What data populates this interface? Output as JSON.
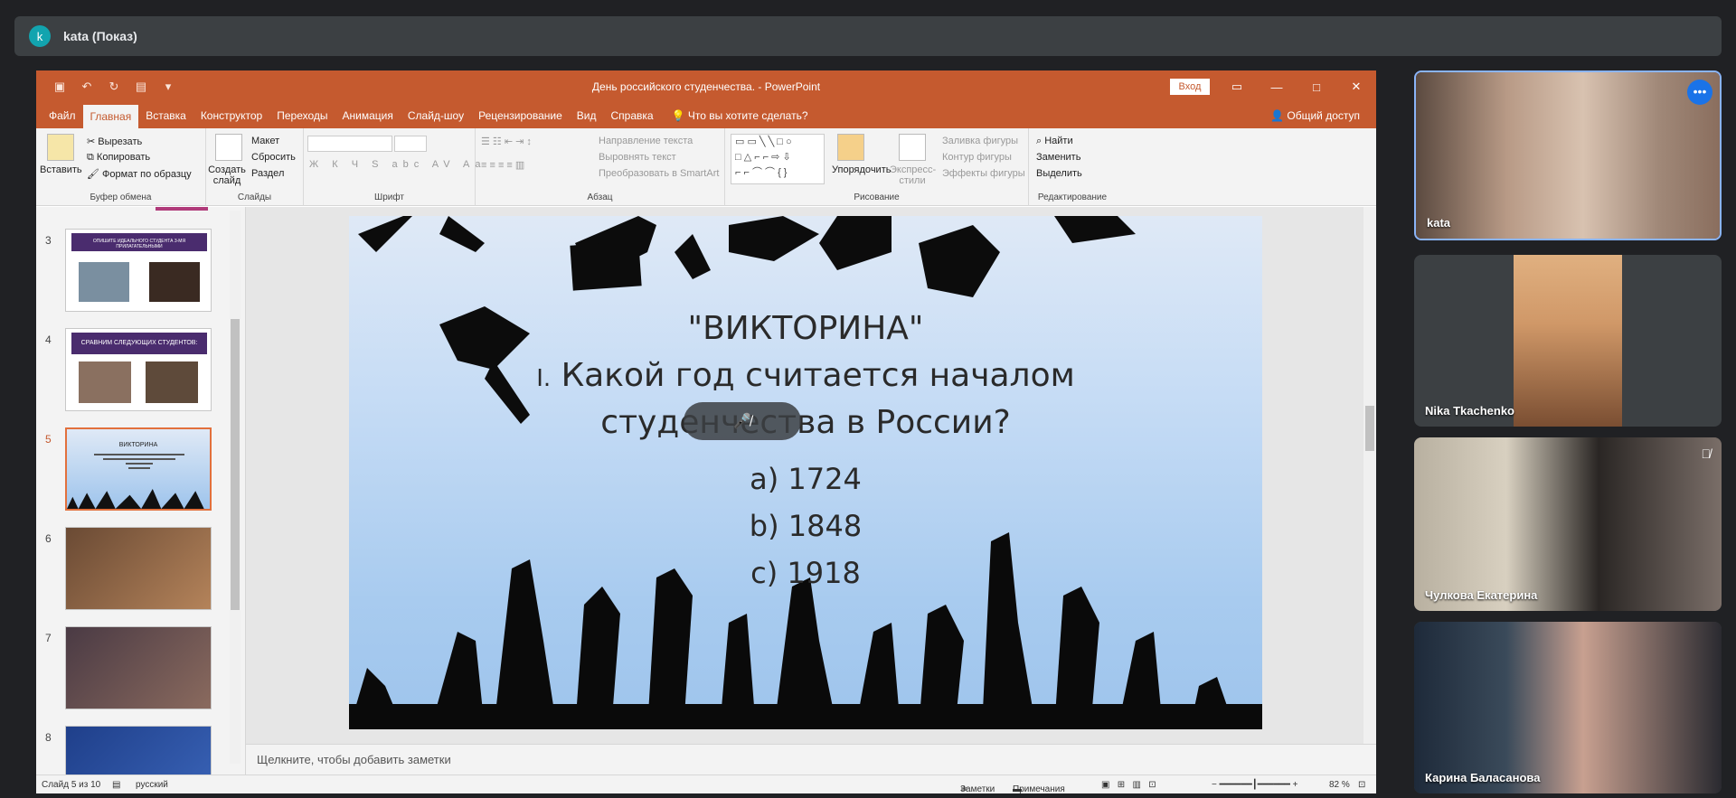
{
  "meet": {
    "avatar_letter": "k",
    "presenter_title": "kata (Показ)",
    "participants": [
      {
        "name": "kata",
        "icon": "more-options-icon"
      },
      {
        "name": "Nika Tkachenko"
      },
      {
        "name": "Чулкова Екатерина",
        "icon": "mic-off-icon"
      },
      {
        "name": "Карина Баласанова"
      }
    ]
  },
  "powerpoint": {
    "window_title": "День российского студенчества.  -  PowerPoint",
    "login_label": "Вход",
    "menu": [
      "Файл",
      "Главная",
      "Вставка",
      "Конструктор",
      "Переходы",
      "Анимация",
      "Слайд-шоу",
      "Рецензирование",
      "Вид",
      "Справка"
    ],
    "active_menu": "Главная",
    "tell_me": "Что вы хотите сделать?",
    "share": "Общий доступ",
    "ribbon": {
      "clipboard": {
        "paste": "Вставить",
        "cut": "Вырезать",
        "copy": "Копировать",
        "format": "Формат по образцу",
        "label": "Буфер обмена"
      },
      "slides": {
        "new": "Создать слайд",
        "layout": "Макет",
        "reset": "Сбросить",
        "section": "Раздел",
        "label": "Слайды"
      },
      "font": {
        "label": "Шрифт",
        "buttons": [
          "Ж",
          "К",
          "Ч",
          "S",
          "abc",
          "AV",
          "Aa"
        ]
      },
      "paragraph": {
        "direction": "Направление текста",
        "align": "Выровнять текст",
        "smartart": "Преобразовать в SmartArt",
        "label": "Абзац"
      },
      "drawing": {
        "arrange": "Упорядочить",
        "styles": "Экспресс-стили",
        "fill": "Заливка фигуры",
        "outline": "Контур фигуры",
        "effects": "Эффекты фигуры",
        "label": "Рисование"
      },
      "editing": {
        "find": "Найти",
        "replace": "Заменить",
        "select": "Выделить",
        "label": "Редактирование"
      }
    },
    "thumbnails": [
      {
        "num": "3",
        "caption": "ОПИШИТЕ ИДЕАЛЬНОГО СТУДЕНТА 3-МЯ ПРИЛАГАТЕЛЬНЫМИ"
      },
      {
        "num": "4",
        "caption": "СРАВНИМ СЛЕДУЮЩИХ СТУДЕНТОВ:"
      },
      {
        "num": "5",
        "caption": "ВИКТОРИНА"
      },
      {
        "num": "6",
        "caption": ""
      },
      {
        "num": "7",
        "caption": ""
      },
      {
        "num": "8",
        "caption": ""
      }
    ],
    "slide": {
      "title": "\"ВИКТОРИНА\"",
      "question_line1": "Какой год считается началом",
      "question_line2": "студенчества в России?",
      "question_prefix": "I.",
      "options": [
        "a) 1724",
        "b) 1848",
        "c) 1918"
      ]
    },
    "notes_placeholder": "Щелкните, чтобы добавить заметки",
    "status": {
      "slide_count": "Слайд 5 из 10",
      "language": "русский",
      "notes": "Заметки",
      "comments": "Примечания",
      "zoom": "82 %"
    }
  },
  "colors": {
    "accent": "#c55a2f",
    "meet_bg": "#202124",
    "tile_bg": "#3c4043",
    "slide_sky": "#a8cbef"
  }
}
